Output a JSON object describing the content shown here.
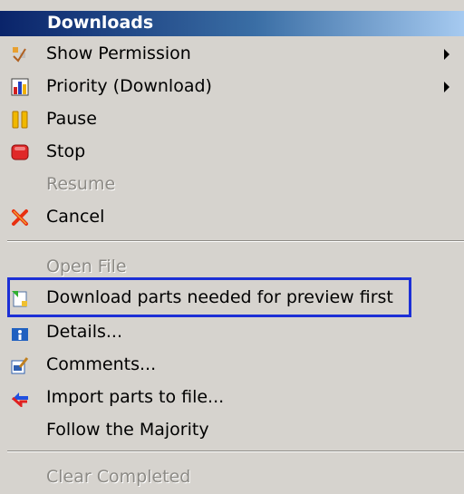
{
  "menu": {
    "title": "Downloads",
    "items": [
      {
        "label": "Show Permission",
        "icon": "permission-icon",
        "submenu": true,
        "enabled": true
      },
      {
        "label": "Priority (Download)",
        "icon": "priority-chart-icon",
        "submenu": true,
        "enabled": true
      },
      {
        "label": "Pause",
        "icon": "pause-icon",
        "enabled": true
      },
      {
        "label": "Stop",
        "icon": "stop-icon",
        "enabled": true
      },
      {
        "label": "Resume",
        "icon": null,
        "enabled": false
      },
      {
        "label": "Cancel",
        "icon": "cancel-x-icon",
        "enabled": true
      },
      {
        "label": "Open File",
        "icon": null,
        "enabled": false
      },
      {
        "label": "Download parts needed for preview first",
        "icon": "download-preview-icon",
        "enabled": true,
        "highlighted": true
      },
      {
        "label": "Details...",
        "icon": "info-icon",
        "enabled": true
      },
      {
        "label": "Comments...",
        "icon": "comment-edit-icon",
        "enabled": true
      },
      {
        "label": "Import parts to file...",
        "icon": "import-arrows-icon",
        "enabled": true
      },
      {
        "label": "Follow the Majority",
        "icon": null,
        "enabled": true
      },
      {
        "label": "Clear Completed",
        "icon": null,
        "enabled": false
      }
    ]
  },
  "colors": {
    "menu_bg": "#d6d3ce",
    "header_start": "#0a246a",
    "highlight_border": "#1c2fd6",
    "disabled_text": "#8c8a85"
  }
}
